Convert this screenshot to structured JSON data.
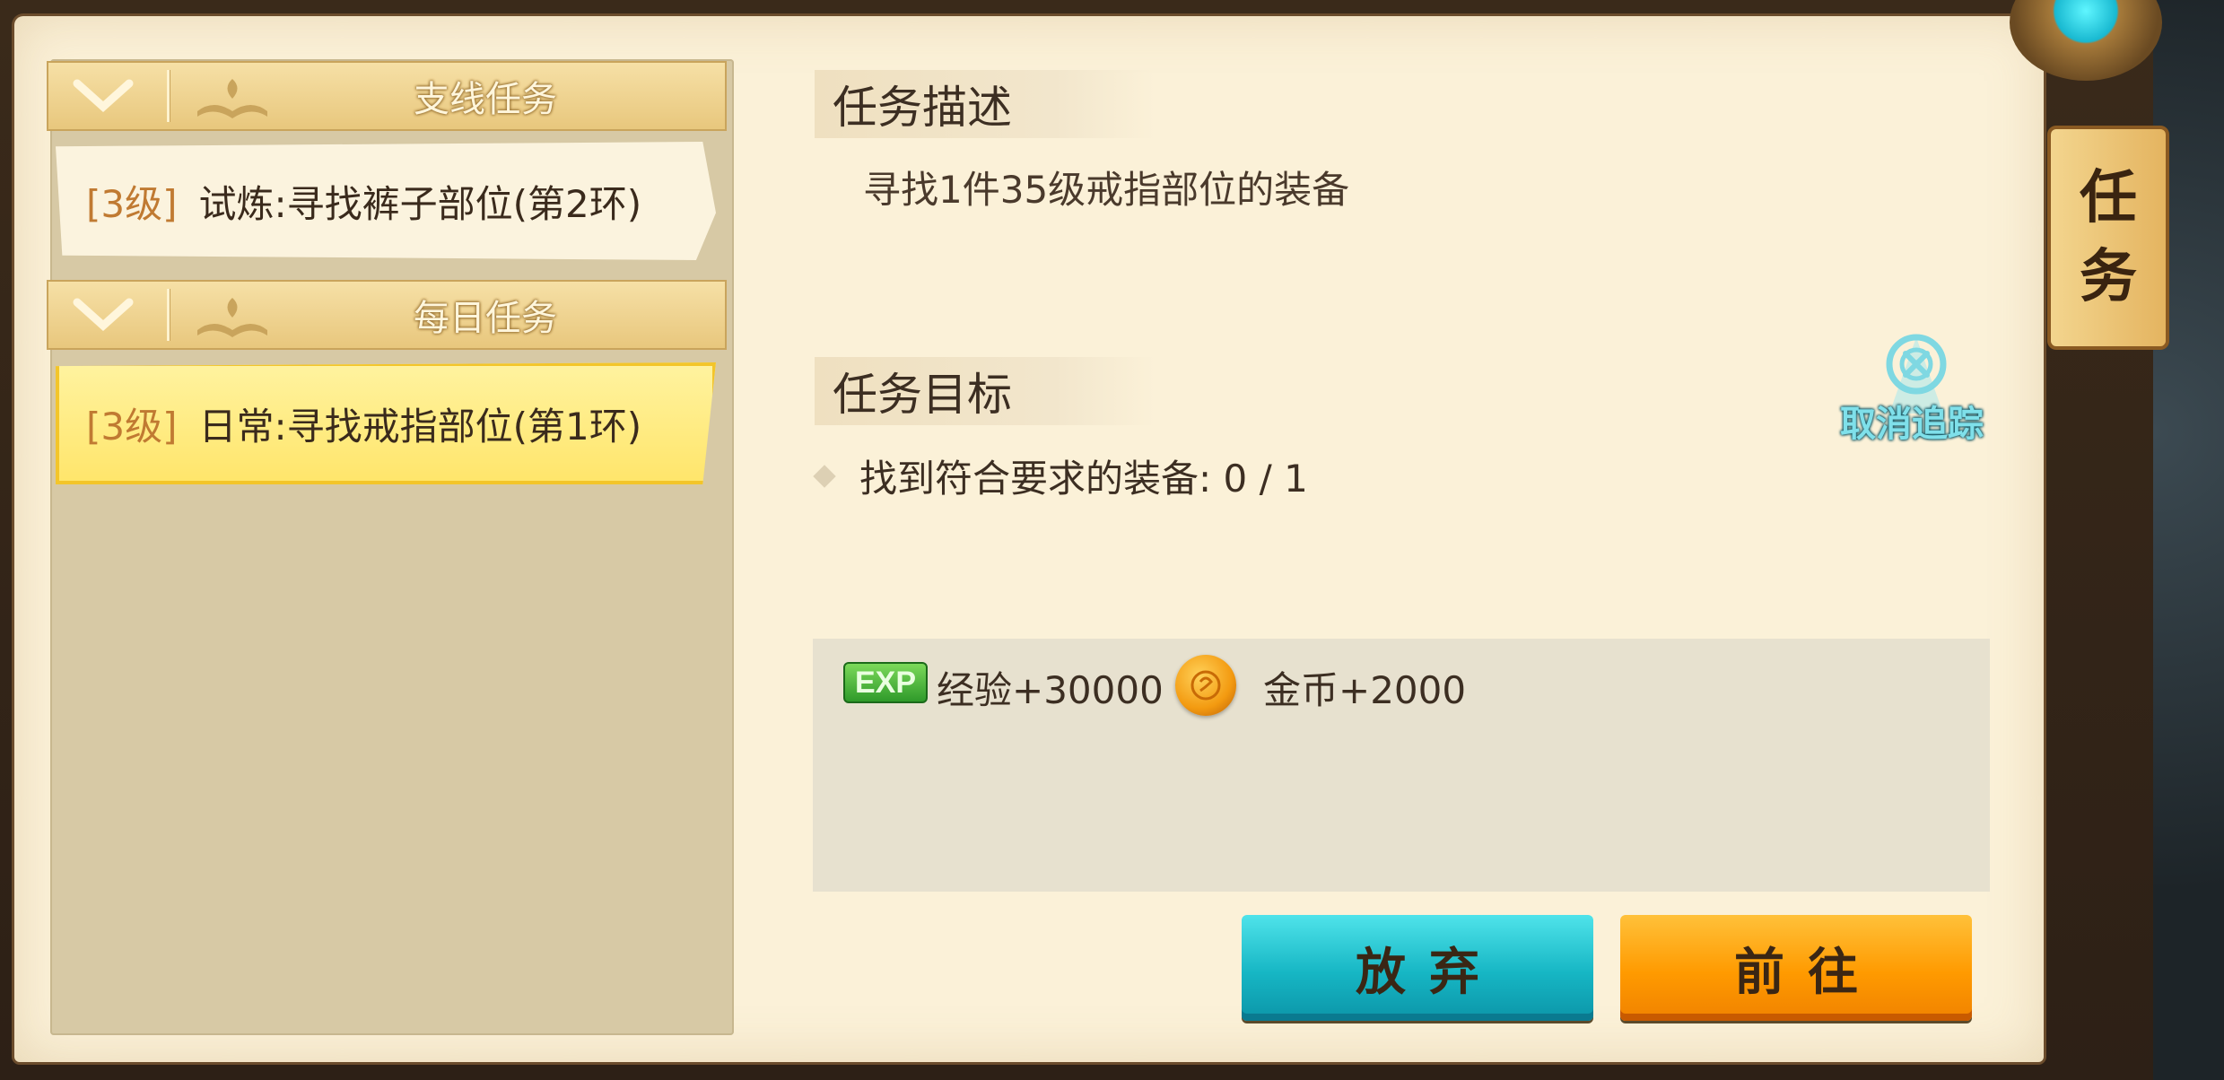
{
  "categories": [
    {
      "label": "支线任务",
      "quests": [
        {
          "level": "[3级]",
          "name": "试炼:寻找裤子部位(第2环)",
          "selected": false
        }
      ]
    },
    {
      "label": "每日任务",
      "quests": [
        {
          "level": "[3级]",
          "name": "日常:寻找戒指部位(第1环)",
          "selected": true
        }
      ]
    }
  ],
  "detail": {
    "description_title": "任务描述",
    "description_text": "寻找1件35级戒指部位的装备",
    "goal_title": "任务目标",
    "goal_text": "找到符合要求的装备: 0 / 1",
    "goal_progress": {
      "current": 0,
      "total": 1
    }
  },
  "rewards": {
    "exp_badge": "EXP",
    "exp_text": "经验+30000",
    "gold_text": "金币+2000",
    "gold_icon": "gold-coin-icon"
  },
  "untrack": {
    "label": "取消追踪",
    "icon": "untrack-crosshair-icon"
  },
  "buttons": {
    "abandon": "放弃",
    "go": "前往"
  },
  "side_tab": {
    "char1": "任",
    "char2": "务"
  },
  "colors": {
    "abandon_button": "#16b6c4",
    "go_button": "#ff9a00",
    "selected_item": "#ffe56a",
    "level_text": "#c07a32",
    "exp_badge": "#2f9a2a"
  }
}
